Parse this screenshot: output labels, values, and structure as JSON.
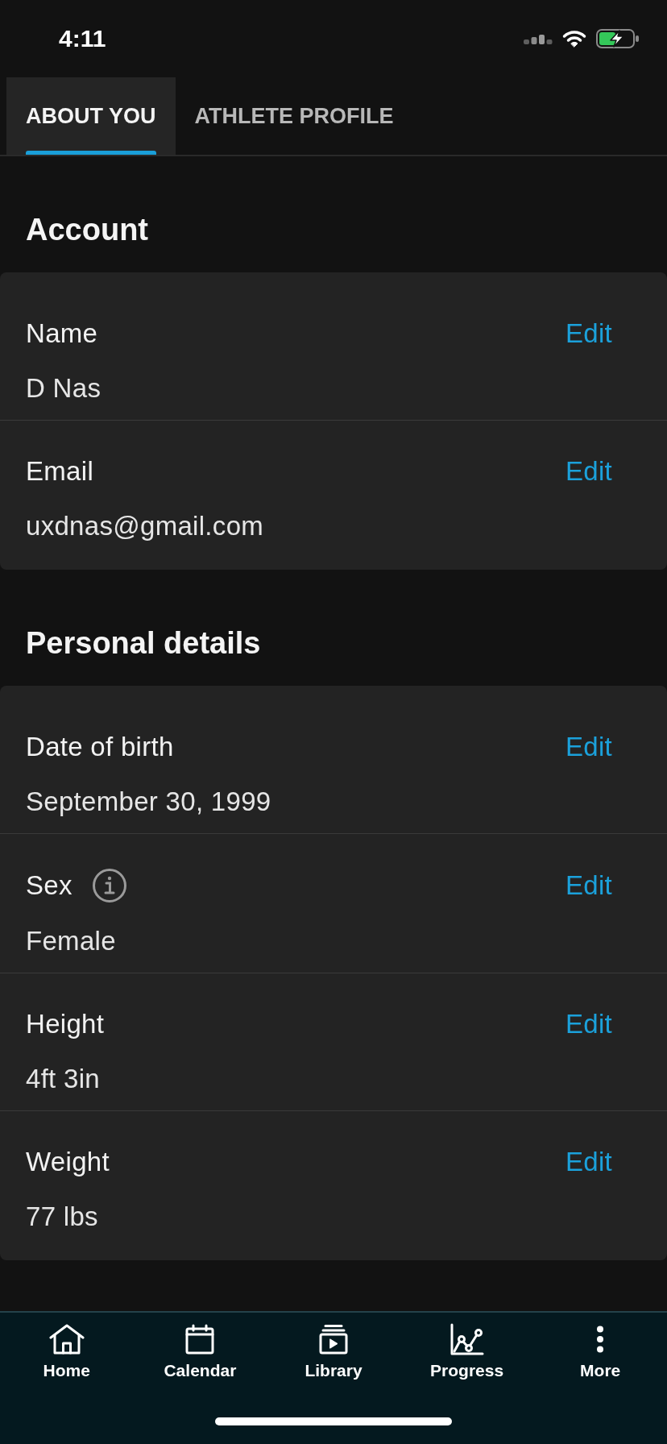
{
  "status_bar": {
    "time": "4:11"
  },
  "tabs": [
    {
      "label": "ABOUT YOU",
      "selected": true
    },
    {
      "label": "ATHLETE PROFILE",
      "selected": false
    }
  ],
  "sections": [
    {
      "title": "Account",
      "fields": [
        {
          "label": "Name",
          "info": false,
          "value": "D Nas",
          "action": "Edit"
        },
        {
          "label": "Email",
          "info": false,
          "value": "uxdnas@gmail.com",
          "action": "Edit"
        }
      ]
    },
    {
      "title": "Personal details",
      "fields": [
        {
          "label": "Date of birth",
          "info": false,
          "value": "September 30, 1999",
          "action": "Edit"
        },
        {
          "label": "Sex",
          "info": true,
          "value": "Female",
          "action": "Edit"
        },
        {
          "label": "Height",
          "info": false,
          "value": "4ft 3in",
          "action": "Edit"
        },
        {
          "label": "Weight",
          "info": false,
          "value": "77 lbs",
          "action": "Edit"
        }
      ]
    }
  ],
  "bottom_nav": [
    {
      "kind": "home",
      "label": "Home"
    },
    {
      "kind": "calendar",
      "label": "Calendar"
    },
    {
      "kind": "library",
      "label": "Library"
    },
    {
      "kind": "progress",
      "label": "Progress"
    },
    {
      "kind": "more",
      "label": "More"
    }
  ]
}
